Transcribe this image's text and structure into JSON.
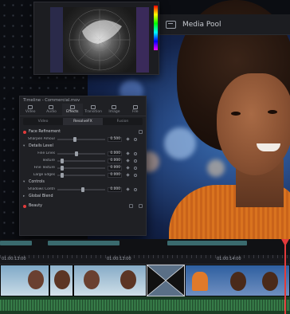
{
  "media_pool": {
    "label": "Media Pool",
    "icon": "media-pool-icon"
  },
  "inspector": {
    "title": "Timeline - Commercial.mov",
    "tabs": [
      {
        "label": "Video",
        "active": false
      },
      {
        "label": "Audio",
        "active": false
      },
      {
        "label": "Effects",
        "active": true
      },
      {
        "label": "Transition",
        "active": false
      },
      {
        "label": "Image",
        "active": false
      },
      {
        "label": "File",
        "active": false
      }
    ],
    "subtabs": [
      {
        "label": "Video",
        "active": false
      },
      {
        "label": "ResolveFX",
        "active": true
      },
      {
        "label": "Fusion",
        "active": false
      }
    ],
    "sections": {
      "face_refinement": {
        "label": "Face Refinement"
      },
      "sharpen": {
        "label": "Sharpen Amount"
      },
      "details": {
        "label": "Details Level"
      },
      "controls": {
        "label": "Controls"
      },
      "global_blend": {
        "label": "Global Blend"
      },
      "beauty": {
        "label": "Beauty"
      }
    },
    "rows": {
      "sharpen_value": "0.500",
      "fine_lines": {
        "label": "Fine Lines",
        "value": "0.000"
      },
      "texture": {
        "label": "Texture",
        "value": "0.000"
      },
      "fine_texture": {
        "label": "Fine Texture",
        "value": "0.000"
      },
      "edges": {
        "label": "Large Edges",
        "value": "0.000"
      },
      "shadows": {
        "label": "Shadows Control",
        "value": "0.000"
      }
    }
  },
  "timeline": {
    "timecodes": [
      "01:00:13:00",
      "01:00:13:00",
      "01:00:14:00"
    ]
  }
}
